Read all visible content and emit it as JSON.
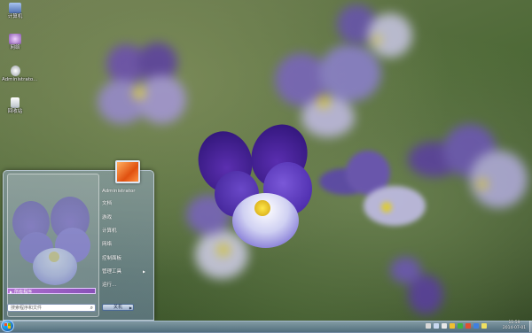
{
  "desktop": {
    "icons": [
      {
        "label": "计算机",
        "icon": "computer-icon",
        "color": "#8aa4d8"
      },
      {
        "label": "网络",
        "icon": "network-icon",
        "color": "#c7a0d8"
      },
      {
        "label": "Administrato...",
        "icon": "user-folder-icon",
        "color": "#e0d8c0"
      },
      {
        "label": "回收站",
        "icon": "recycle-bin-icon",
        "color": "#d8e0e8"
      }
    ]
  },
  "start_menu": {
    "all_programs": "所有程序",
    "search_placeholder": "搜索程序和文件",
    "user_picture": "flower-avatar",
    "right_items": [
      {
        "label": "Administrator",
        "has_submenu": false
      },
      {
        "label": "文档",
        "has_submenu": false
      },
      {
        "label": "游戏",
        "has_submenu": false
      },
      {
        "label": "计算机",
        "has_submenu": false
      },
      {
        "label": "网络",
        "has_submenu": false
      },
      {
        "label": "控制面板",
        "has_submenu": false
      },
      {
        "label": "管理工具",
        "has_submenu": true
      },
      {
        "label": "运行...",
        "has_submenu": false
      }
    ],
    "shutdown_label": "关机"
  },
  "taskbar": {
    "start_button": "windows-orb",
    "tray_icons": [
      "action-center-icon",
      "network-icon",
      "volume-icon",
      "ime-icon",
      "security-icon",
      "flag-icon",
      "power-icon",
      "input-icon"
    ],
    "clock_time": "11:59",
    "clock_date": "2014-07-01"
  },
  "colors": {
    "all_programs_bar": "#9a5fc8",
    "wallpaper_violet": "#4a2a9a",
    "wallpaper_yellow": "#f0d020"
  }
}
